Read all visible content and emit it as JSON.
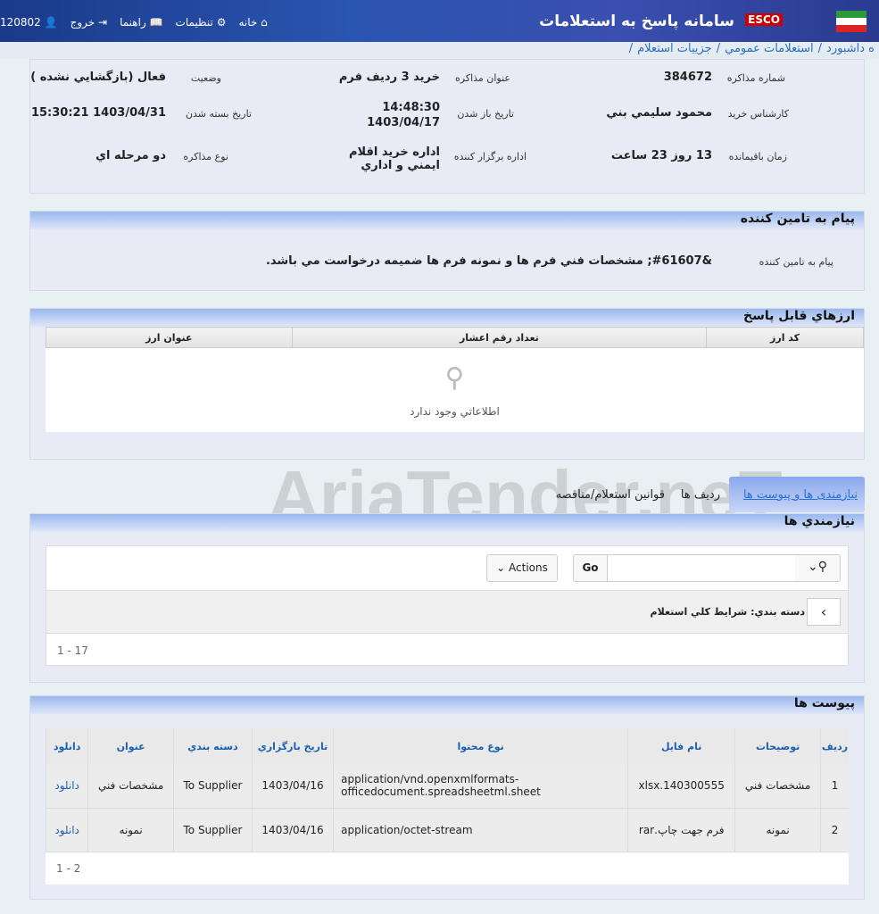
{
  "header": {
    "title": "سامانه پاسخ به استعلامات",
    "logo_text": "ESCO",
    "nav": [
      {
        "label": "120802",
        "icon": "user-icon"
      },
      {
        "label": "خروج",
        "icon": "logout-icon"
      },
      {
        "label": "راهنما",
        "icon": "book-icon"
      },
      {
        "label": "تنظيمات",
        "icon": "gear-icon"
      },
      {
        "label": "خانه",
        "icon": "home-icon"
      }
    ]
  },
  "breadcrumb": [
    "ه داشبورد",
    "استعلامات عمومي",
    "جزييات استعلام"
  ],
  "info": {
    "number_label": "شماره مذاكره",
    "number": "384672",
    "subject_label": "عنوان مذاكره",
    "subject": "خريد 3 رديف فرم",
    "status_label": "وضعيت",
    "status": "فعال (بازگشايي نشده )",
    "expert_label": "كارشناس خريد",
    "expert": "محمود سليمي بني",
    "open_label": "تاريخ باز شدن",
    "open_time": "14:48:30",
    "open_date": "1403/04/17",
    "close_label": "تاريخ بسته شدن",
    "close": "1403/04/31 15:30:21",
    "remaining_label": "زمان باقيمانده",
    "remaining": "13 روز 23 ساعت",
    "dept_label": "اداره برگزار كننده",
    "dept": "اداره خريد اقلام ايمني و اداري",
    "type_label": "نوع مذاكره",
    "type": "دو مرحله اي"
  },
  "message": {
    "title": "پيام به تامين كننده",
    "label": "پيام به تامين كننده",
    "text": "&#61607; مشخصات فني فرم ها و نمونه فرم ها ضميمه درخواست مي باشد."
  },
  "currencies": {
    "title": "ارزهاي قابل پاسخ",
    "columns": [
      "كد ارز",
      "تعداد رقم اعشار",
      "عنوان ارز"
    ],
    "empty": "اطلاعاتي وجود ندارد"
  },
  "tabs": [
    {
      "label": "نيازمندی ها و پيوست ها",
      "active": true
    },
    {
      "label": "رديف ها"
    },
    {
      "label": "قوانين استعلام/مناقصه"
    }
  ],
  "requirements": {
    "title": "نيازمندي ها",
    "go": "Go",
    "actions": "Actions",
    "search_value": "",
    "group": "دسته بندي: شرايط كلي استعلام",
    "pager": "1 - 17"
  },
  "attachments": {
    "title": "پيوست ها",
    "columns": [
      "رديف",
      "توضيحات",
      "نام فايل",
      "نوع محتوا",
      "تاريخ بارگزاري",
      "دسته بندي",
      "عنوان",
      "دانلود"
    ],
    "rows": [
      [
        "1",
        "مشخصات فني",
        "xlsx.140300555",
        "application/vnd.openxmlformats-officedocument.spreadsheetml.sheet",
        "1403/04/16",
        "To Supplier",
        "مشخصات فني",
        "دانلود"
      ],
      [
        "2",
        "نمونه",
        "فرم جهت چاپ.rar",
        "application/octet-stream",
        "1403/04/16",
        "To Supplier",
        "نمونه",
        "دانلود"
      ]
    ],
    "pager": "1 - 2"
  },
  "watermark": "AriaTender.neT"
}
